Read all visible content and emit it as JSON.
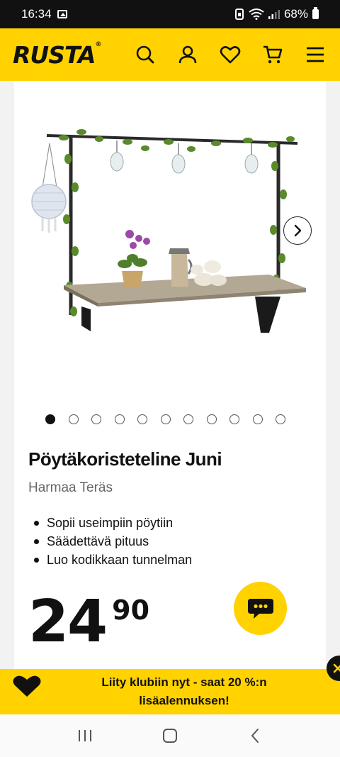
{
  "status_bar": {
    "time": "16:34",
    "battery": "68%"
  },
  "header": {
    "logo": "RUSTA",
    "icons": [
      "search-icon",
      "user-icon",
      "heart-icon",
      "cart-icon",
      "menu-icon"
    ]
  },
  "gallery": {
    "image_count": 11,
    "active_index": 0
  },
  "product": {
    "title": "Pöytäkoristeteline Juni",
    "subtitle": "Harmaa Teräs",
    "features": [
      "Sopii useimpiin pöytiin",
      "Säädettävä pituus",
      "Luo kodikkaan tunnelman"
    ],
    "price_main": "24",
    "price_cents": "90"
  },
  "banner": {
    "text": "Liity klubiin nyt - saat 20 %:n lisäalennuksen!"
  },
  "colors": {
    "brand_yellow": "#ffd200",
    "text_dark": "#111111"
  }
}
